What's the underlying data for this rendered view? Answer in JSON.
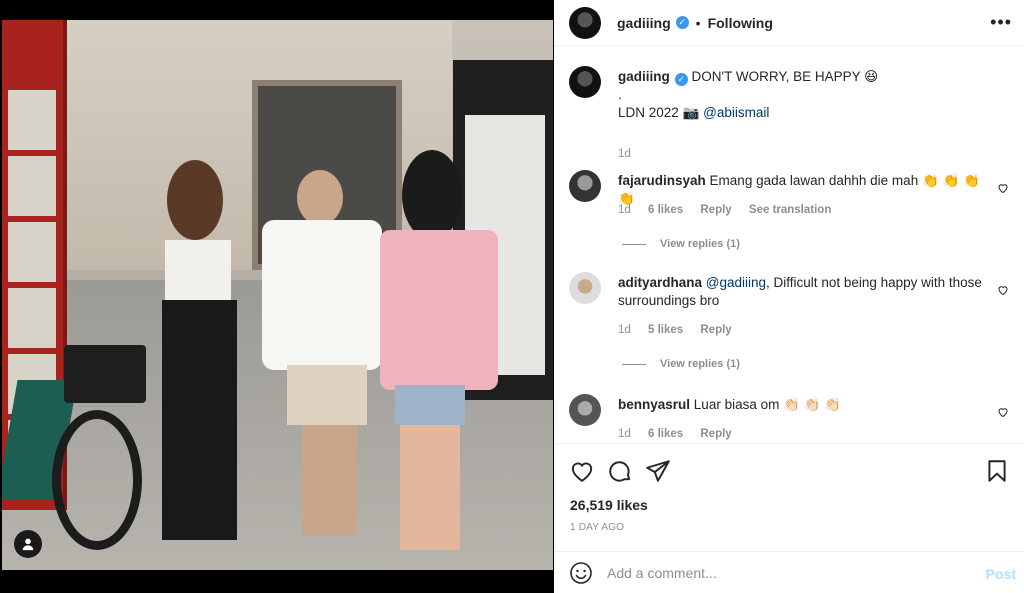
{
  "header": {
    "username": "gadiiing",
    "separator": "•",
    "follow_status": "Following",
    "more_label": "•••"
  },
  "caption": {
    "username": "gadiiing",
    "line1": "DON'T WORRY, BE HAPPY 😆",
    "line2": ".",
    "line3_text": "LDN 2022 📷",
    "line3_mention": "@abiismail",
    "age": "1d"
  },
  "comments": [
    {
      "username": "fajarudinsyah",
      "mention": "",
      "text": "Emang gada lawan dahhh die mah 👏 👏 👏 👏",
      "age": "1d",
      "likes": "6 likes",
      "reply": "Reply",
      "translate": "See translation",
      "view_replies": "View replies (1)"
    },
    {
      "username": "adityardhana",
      "mention": "@gadiiing",
      "text": ", Difficult not being happy with those surroundings bro",
      "age": "1d",
      "likes": "5 likes",
      "reply": "Reply",
      "view_replies": "View replies (1)"
    },
    {
      "username": "bennyasrul",
      "mention": "",
      "text": "Luar biasa om 👏🏻 👏🏻 👏🏻",
      "age": "1d",
      "likes": "6 likes",
      "reply": "Reply"
    }
  ],
  "stats": {
    "likes": "26,519 likes",
    "time": "1 DAY AGO"
  },
  "comment_input": {
    "placeholder": "Add a comment...",
    "post_label": "Post"
  },
  "colors": {
    "verified": "#3897f0",
    "mention": "#00376b",
    "post_disabled": "#b2dffc"
  }
}
